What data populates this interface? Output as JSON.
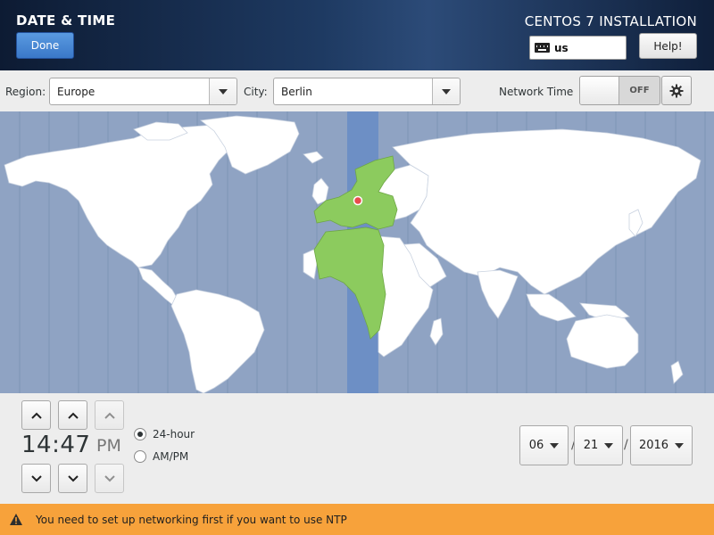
{
  "header": {
    "page_title": "DATE & TIME",
    "done_label": "Done",
    "install_title": "CENTOS 7 INSTALLATION",
    "keyboard_layout": "us",
    "help_label": "Help!"
  },
  "toolbar": {
    "region_label": "Region:",
    "region_value": "Europe",
    "city_label": "City:",
    "city_value": "Berlin",
    "network_time_label": "Network Time",
    "network_time_state": "OFF"
  },
  "map": {
    "selected_timezone_color": "#8ccb5e",
    "ocean_color": "#8fa3c3",
    "highlight_band_color": "#6d8fc5",
    "land_color": "#ffffff",
    "pin_color": "#e84c4c"
  },
  "time": {
    "hours_minutes": "14:47",
    "period": "PM",
    "format_24h_label": "24-hour",
    "format_ampm_label": "AM/PM",
    "selected_format": "24-hour"
  },
  "date": {
    "month": "06",
    "day": "21",
    "year": "2016",
    "separator": "/"
  },
  "warning": {
    "message": "You need to set up networking first if you want to use NTP",
    "color": "#f7a23b"
  }
}
